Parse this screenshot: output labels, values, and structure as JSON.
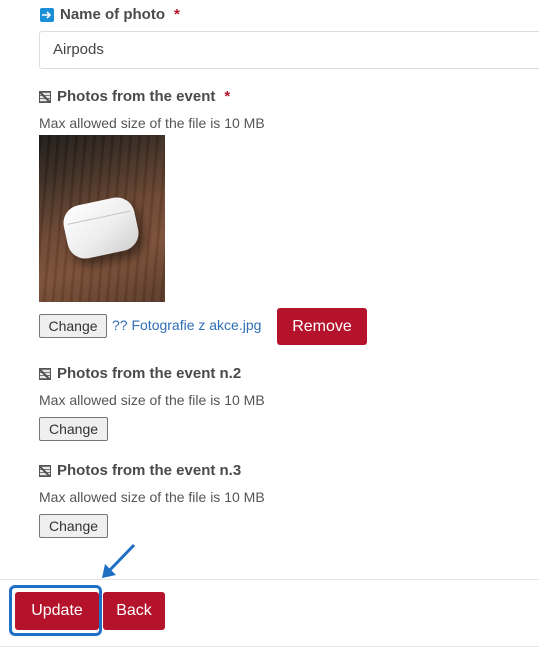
{
  "name_field": {
    "label": "Name of photo",
    "required_mark": "*",
    "value": "Airpods"
  },
  "photo_1": {
    "label": "Photos from the event",
    "required_mark": "*",
    "hint": "Max allowed size of the file is 10 MB",
    "change_label": "Change",
    "file_name": "?? Fotografie z akce.jpg",
    "remove_label": "Remove"
  },
  "photo_2": {
    "label": "Photos from the event n.2",
    "hint": "Max allowed size of the file is 10 MB",
    "change_label": "Change"
  },
  "photo_3": {
    "label": "Photos from the event n.3",
    "hint": "Max allowed size of the file is 10 MB",
    "change_label": "Change"
  },
  "actions": {
    "update_label": "Update",
    "back_label": "Back"
  },
  "colors": {
    "primary_button": "#b5132c",
    "focus_ring": "#1f6fc5",
    "link": "#2f6fb5",
    "icon_blue": "#1a8fd8"
  }
}
